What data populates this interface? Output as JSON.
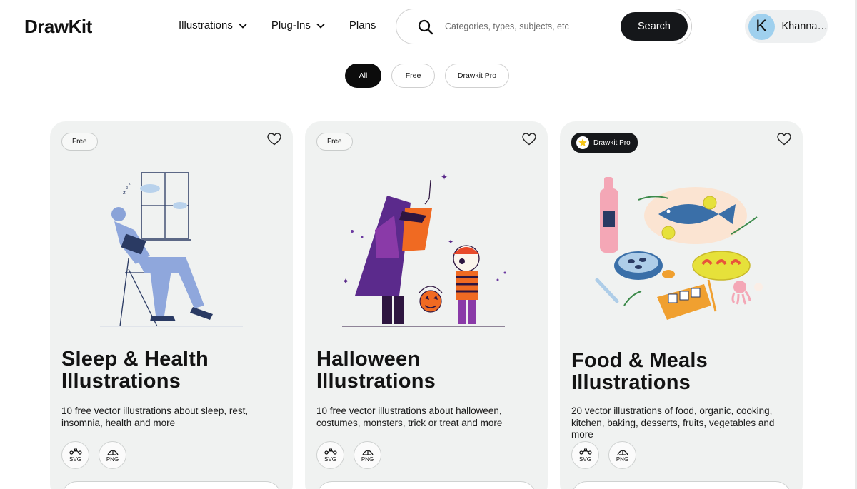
{
  "header": {
    "logo": "DrawKit",
    "nav": [
      {
        "label": "Illustrations",
        "has_dropdown": true
      },
      {
        "label": "Plug-Ins",
        "has_dropdown": true
      },
      {
        "label": "Plans",
        "has_dropdown": false
      }
    ],
    "search": {
      "placeholder": "Categories, types, subjects, etc",
      "value": "",
      "button_label": "Search",
      "icon": "search-icon"
    },
    "user": {
      "initial": "K",
      "name": "Khanna…",
      "avatar_color": "#9fd0ee"
    }
  },
  "filters": [
    {
      "label": "All",
      "active": true
    },
    {
      "label": "Free",
      "active": false
    },
    {
      "label": "Drawkit Pro",
      "active": false
    }
  ],
  "cards": [
    {
      "badge": "Free",
      "badge_type": "free",
      "title": "Sleep & Health Illustrations",
      "description": "10 free vector illustrations about sleep, rest, insomnia, health and more",
      "formats": [
        "SVG",
        "PNG"
      ],
      "art": "sleeping-person-illustration"
    },
    {
      "badge": "Free",
      "badge_type": "free",
      "title": "Halloween Illustrations",
      "description": "10 free vector illustrations about halloween, costumes, monsters, trick or treat and more",
      "formats": [
        "SVG",
        "PNG"
      ],
      "art": "halloween-costume-illustration"
    },
    {
      "badge": "Drawkit Pro",
      "badge_type": "pro",
      "title": "Food & Meals Illustrations",
      "description": "20 vector illustrations of food, organic, cooking, kitchen, baking, desserts, fruits, vegetables and more",
      "formats": [
        "SVG",
        "PNG"
      ],
      "art": "food-meals-illustration"
    }
  ],
  "colors": {
    "primary_dark": "#15171a",
    "card_bg": "#f0f2f1",
    "pro_star": "#f5c518"
  }
}
